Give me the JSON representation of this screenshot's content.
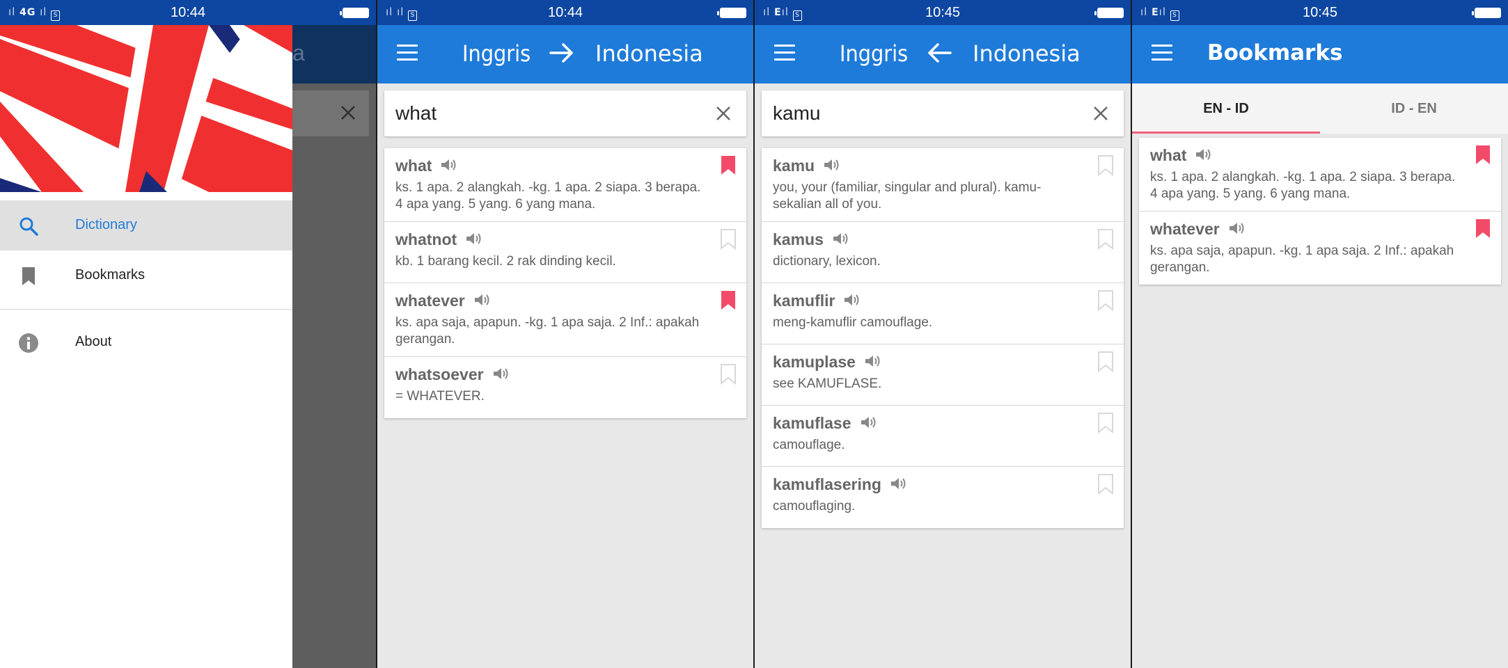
{
  "screens": {
    "s1": {
      "status": {
        "network": "4G",
        "time": "10:44"
      },
      "ghost_title_fragment": "a",
      "drawer": {
        "items": [
          {
            "label": "Dictionary",
            "icon": "search-icon",
            "active": true
          },
          {
            "label": "Bookmarks",
            "icon": "bookmark-icon",
            "active": false
          },
          {
            "label": "About",
            "icon": "info-icon",
            "active": false
          }
        ]
      }
    },
    "s2": {
      "status": {
        "network": "",
        "time": "10:44"
      },
      "appbar": {
        "lang_left": "Inggris",
        "lang_right": "Indonesia",
        "direction": "arrow-right-icon"
      },
      "search": {
        "value": "what"
      },
      "results": [
        {
          "word": "what",
          "def": "ks. 1 apa. 2 alangkah. -kg. 1 apa. 2 siapa. 3 berapa. 4 apa yang. 5 yang. 6 yang mana.",
          "bookmarked": true
        },
        {
          "word": "whatnot",
          "def": "kb. 1 barang kecil. 2 rak dinding kecil.",
          "bookmarked": false
        },
        {
          "word": "whatever",
          "def": "ks. apa saja, apapun. -kg. 1 apa saja. 2 Inf.: apakah gerangan.",
          "bookmarked": true
        },
        {
          "word": "whatsoever",
          "def": "=   WHATEVER.",
          "bookmarked": false
        }
      ]
    },
    "s3": {
      "status": {
        "network": "E",
        "time": "10:45"
      },
      "appbar": {
        "lang_left": "Inggris",
        "lang_right": "Indonesia",
        "direction": "arrow-left-icon"
      },
      "search": {
        "value": "kamu"
      },
      "results": [
        {
          "word": "kamu",
          "def": "you, your (familiar, singular and plural).  kamu-sekalian all of you.",
          "bookmarked": false
        },
        {
          "word": "kamus",
          "def": "dictionary, lexicon.",
          "bookmarked": false
        },
        {
          "word": "kamuflir",
          "def": "meng-kamuflir camouflage.",
          "bookmarked": false
        },
        {
          "word": "kamuplase",
          "def": "see  KAMUFLASE.",
          "bookmarked": false
        },
        {
          "word": "kamuflase",
          "def": "camouflage.",
          "bookmarked": false
        },
        {
          "word": "kamuflasering",
          "def": "camouflaging.",
          "bookmarked": false
        }
      ]
    },
    "s4": {
      "status": {
        "network": "E",
        "time": "10:45"
      },
      "appbar": {
        "title": "Bookmarks"
      },
      "tabs": [
        {
          "label": "EN - ID",
          "active": true
        },
        {
          "label": "ID - EN",
          "active": false
        }
      ],
      "results": [
        {
          "word": "what",
          "def": "ks. 1 apa. 2 alangkah. -kg. 1 apa. 2 siapa. 3 berapa. 4 apa yang. 5 yang. 6 yang mana.",
          "bookmarked": true
        },
        {
          "word": "whatever",
          "def": "ks. apa saja, apapun. -kg. 1 apa saja. 2 Inf.: apakah gerangan.",
          "bookmarked": true
        }
      ]
    }
  },
  "colors": {
    "statusbar": "#0e47a1",
    "appbar": "#1f7bd9",
    "bookmark_active": "#f24b6a",
    "bookmark_inactive": "#d8d8d8",
    "tab_indicator": "#f0607c"
  }
}
